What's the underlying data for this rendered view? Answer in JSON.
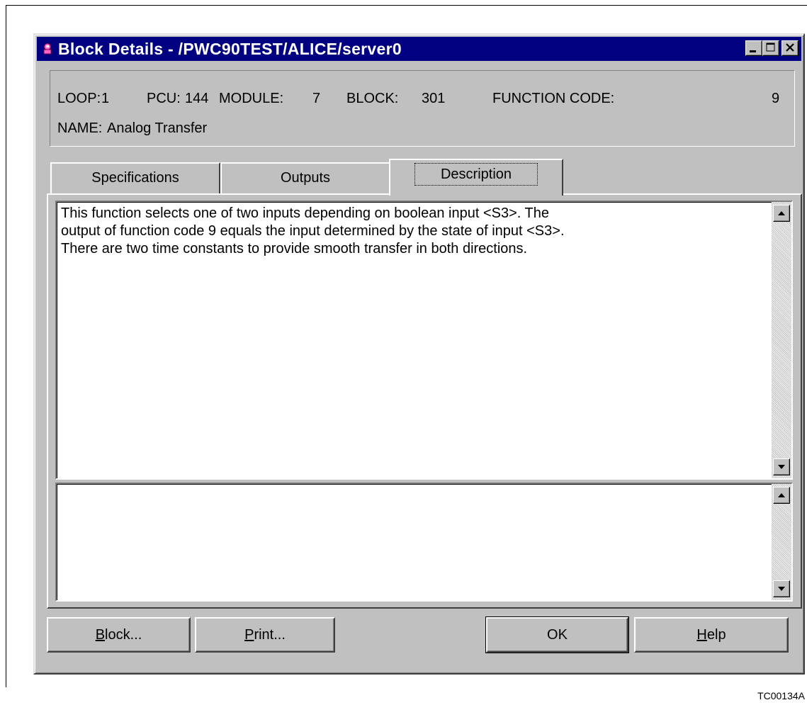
{
  "window": {
    "title": "Block Details - /PWC90TEST/ALICE/server0"
  },
  "info": {
    "loop_label": "LOOP:",
    "loop_value": "1",
    "pcu_label": "PCU:",
    "pcu_value": "144",
    "module_label": "MODULE:",
    "module_value": "7",
    "block_label": "BLOCK:",
    "block_value": "301",
    "function_code_label": "FUNCTION CODE:",
    "function_code_value": "9",
    "name_label": "NAME:",
    "name_value": "Analog Transfer"
  },
  "tabs": [
    {
      "label": "Specifications"
    },
    {
      "label": "Outputs"
    },
    {
      "label": "Description",
      "active": true
    }
  ],
  "description": {
    "lines": [
      "This function selects one of two inputs depending on boolean input <S3>. The",
      "output of function code 9 equals the input determined by the state of input <S3>.",
      "There are two time constants to provide smooth transfer in both directions."
    ]
  },
  "notes": {
    "text": ""
  },
  "buttons": {
    "block": {
      "prefix": "",
      "mnemonic": "B",
      "rest": "lock..."
    },
    "print": {
      "prefix": "",
      "mnemonic": "P",
      "rest": "rint..."
    },
    "ok": {
      "label": "OK"
    },
    "help": {
      "prefix": "",
      "mnemonic": "H",
      "rest": "elp"
    }
  },
  "figure_id": "TC00134A",
  "colors": {
    "titlebar": "#000080",
    "face": "#c0c0c0"
  },
  "icons": {
    "app": "app-icon",
    "minimize": "minimize-icon",
    "maximize": "maximize-icon",
    "close": "close-icon",
    "scroll_up": "scroll-up-arrow-icon",
    "scroll_down": "scroll-down-arrow-icon"
  }
}
